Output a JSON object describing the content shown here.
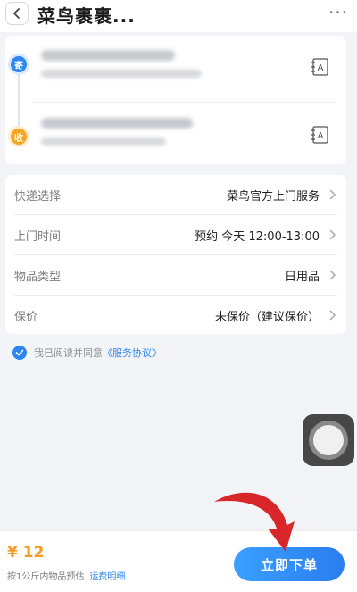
{
  "header": {
    "back_icon": "chevron-left-icon",
    "title": "菜鸟裹裹...",
    "more_label": "···"
  },
  "address": {
    "sender_tag": "寄",
    "receiver_tag": "收",
    "addressbook_icon": "address-book-icon"
  },
  "options": [
    {
      "label": "快递选择",
      "value": "菜鸟官方上门服务"
    },
    {
      "label": "上门时间",
      "value": "预约 今天 12:00-13:00"
    },
    {
      "label": "物品类型",
      "value": "日用品"
    },
    {
      "label": "保价",
      "value": "未保价（建议保价）"
    }
  ],
  "agreement": {
    "text": "我已阅读并同意",
    "link": "《服务协议》"
  },
  "footer": {
    "price": "¥ 12",
    "note": "按1公斤内物品预估",
    "detail_link": "运费明细",
    "order_button": "立即下单"
  },
  "colors": {
    "accent_blue": "#2d86ef",
    "price_orange": "#f59a23",
    "annotation_red": "#d8262b"
  }
}
